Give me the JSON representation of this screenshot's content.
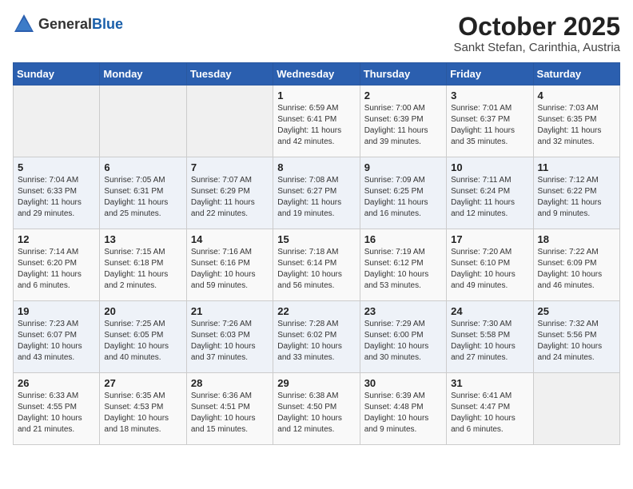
{
  "header": {
    "logo_general": "General",
    "logo_blue": "Blue",
    "month": "October 2025",
    "location": "Sankt Stefan, Carinthia, Austria"
  },
  "weekdays": [
    "Sunday",
    "Monday",
    "Tuesday",
    "Wednesday",
    "Thursday",
    "Friday",
    "Saturday"
  ],
  "weeks": [
    [
      {
        "day": "",
        "content": ""
      },
      {
        "day": "",
        "content": ""
      },
      {
        "day": "",
        "content": ""
      },
      {
        "day": "1",
        "content": "Sunrise: 6:59 AM\nSunset: 6:41 PM\nDaylight: 11 hours\nand 42 minutes."
      },
      {
        "day": "2",
        "content": "Sunrise: 7:00 AM\nSunset: 6:39 PM\nDaylight: 11 hours\nand 39 minutes."
      },
      {
        "day": "3",
        "content": "Sunrise: 7:01 AM\nSunset: 6:37 PM\nDaylight: 11 hours\nand 35 minutes."
      },
      {
        "day": "4",
        "content": "Sunrise: 7:03 AM\nSunset: 6:35 PM\nDaylight: 11 hours\nand 32 minutes."
      }
    ],
    [
      {
        "day": "5",
        "content": "Sunrise: 7:04 AM\nSunset: 6:33 PM\nDaylight: 11 hours\nand 29 minutes."
      },
      {
        "day": "6",
        "content": "Sunrise: 7:05 AM\nSunset: 6:31 PM\nDaylight: 11 hours\nand 25 minutes."
      },
      {
        "day": "7",
        "content": "Sunrise: 7:07 AM\nSunset: 6:29 PM\nDaylight: 11 hours\nand 22 minutes."
      },
      {
        "day": "8",
        "content": "Sunrise: 7:08 AM\nSunset: 6:27 PM\nDaylight: 11 hours\nand 19 minutes."
      },
      {
        "day": "9",
        "content": "Sunrise: 7:09 AM\nSunset: 6:25 PM\nDaylight: 11 hours\nand 16 minutes."
      },
      {
        "day": "10",
        "content": "Sunrise: 7:11 AM\nSunset: 6:24 PM\nDaylight: 11 hours\nand 12 minutes."
      },
      {
        "day": "11",
        "content": "Sunrise: 7:12 AM\nSunset: 6:22 PM\nDaylight: 11 hours\nand 9 minutes."
      }
    ],
    [
      {
        "day": "12",
        "content": "Sunrise: 7:14 AM\nSunset: 6:20 PM\nDaylight: 11 hours\nand 6 minutes."
      },
      {
        "day": "13",
        "content": "Sunrise: 7:15 AM\nSunset: 6:18 PM\nDaylight: 11 hours\nand 2 minutes."
      },
      {
        "day": "14",
        "content": "Sunrise: 7:16 AM\nSunset: 6:16 PM\nDaylight: 10 hours\nand 59 minutes."
      },
      {
        "day": "15",
        "content": "Sunrise: 7:18 AM\nSunset: 6:14 PM\nDaylight: 10 hours\nand 56 minutes."
      },
      {
        "day": "16",
        "content": "Sunrise: 7:19 AM\nSunset: 6:12 PM\nDaylight: 10 hours\nand 53 minutes."
      },
      {
        "day": "17",
        "content": "Sunrise: 7:20 AM\nSunset: 6:10 PM\nDaylight: 10 hours\nand 49 minutes."
      },
      {
        "day": "18",
        "content": "Sunrise: 7:22 AM\nSunset: 6:09 PM\nDaylight: 10 hours\nand 46 minutes."
      }
    ],
    [
      {
        "day": "19",
        "content": "Sunrise: 7:23 AM\nSunset: 6:07 PM\nDaylight: 10 hours\nand 43 minutes."
      },
      {
        "day": "20",
        "content": "Sunrise: 7:25 AM\nSunset: 6:05 PM\nDaylight: 10 hours\nand 40 minutes."
      },
      {
        "day": "21",
        "content": "Sunrise: 7:26 AM\nSunset: 6:03 PM\nDaylight: 10 hours\nand 37 minutes."
      },
      {
        "day": "22",
        "content": "Sunrise: 7:28 AM\nSunset: 6:02 PM\nDaylight: 10 hours\nand 33 minutes."
      },
      {
        "day": "23",
        "content": "Sunrise: 7:29 AM\nSunset: 6:00 PM\nDaylight: 10 hours\nand 30 minutes."
      },
      {
        "day": "24",
        "content": "Sunrise: 7:30 AM\nSunset: 5:58 PM\nDaylight: 10 hours\nand 27 minutes."
      },
      {
        "day": "25",
        "content": "Sunrise: 7:32 AM\nSunset: 5:56 PM\nDaylight: 10 hours\nand 24 minutes."
      }
    ],
    [
      {
        "day": "26",
        "content": "Sunrise: 6:33 AM\nSunset: 4:55 PM\nDaylight: 10 hours\nand 21 minutes."
      },
      {
        "day": "27",
        "content": "Sunrise: 6:35 AM\nSunset: 4:53 PM\nDaylight: 10 hours\nand 18 minutes."
      },
      {
        "day": "28",
        "content": "Sunrise: 6:36 AM\nSunset: 4:51 PM\nDaylight: 10 hours\nand 15 minutes."
      },
      {
        "day": "29",
        "content": "Sunrise: 6:38 AM\nSunset: 4:50 PM\nDaylight: 10 hours\nand 12 minutes."
      },
      {
        "day": "30",
        "content": "Sunrise: 6:39 AM\nSunset: 4:48 PM\nDaylight: 10 hours\nand 9 minutes."
      },
      {
        "day": "31",
        "content": "Sunrise: 6:41 AM\nSunset: 4:47 PM\nDaylight: 10 hours\nand 6 minutes."
      },
      {
        "day": "",
        "content": ""
      }
    ]
  ]
}
